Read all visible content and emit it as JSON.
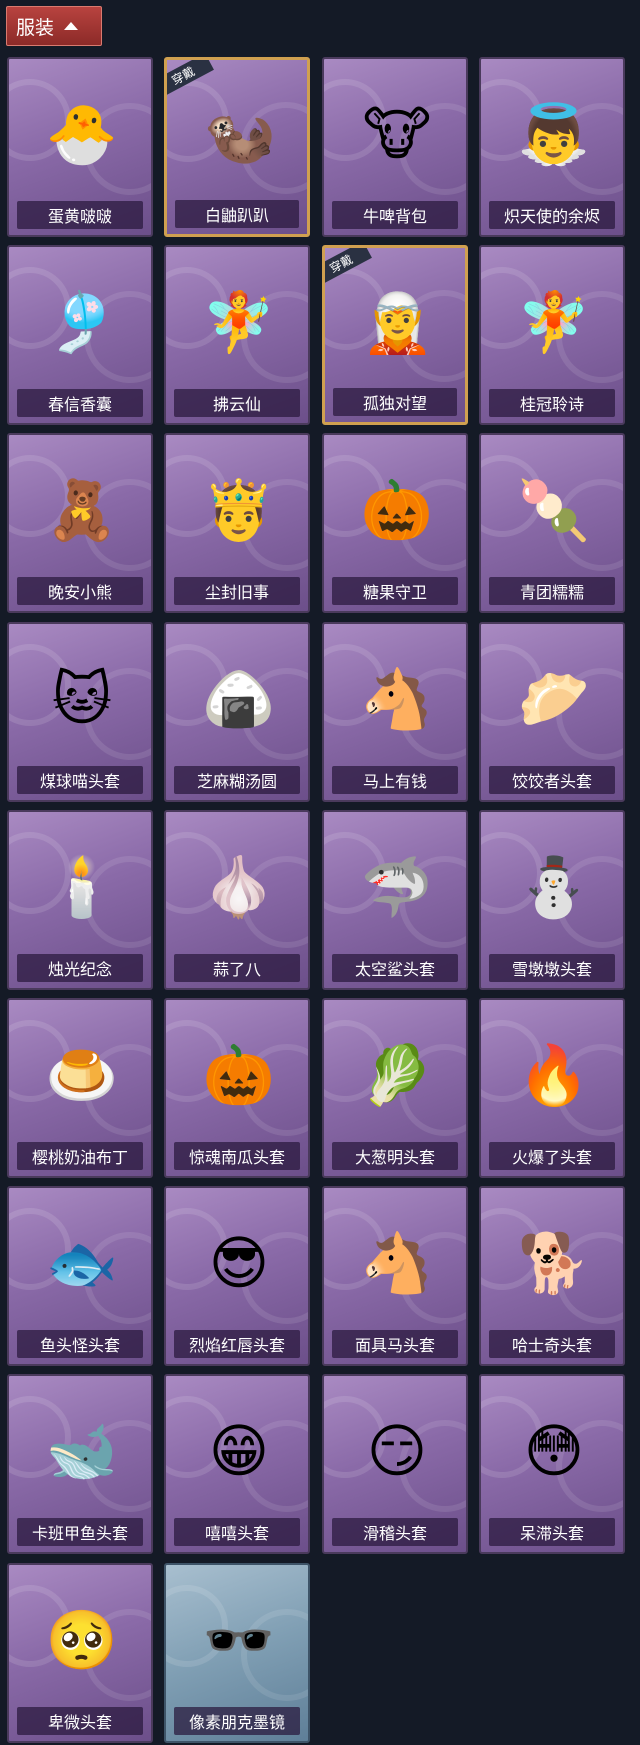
{
  "header": {
    "title": "服装"
  },
  "equipped_badge": "穿戴",
  "items": [
    {
      "name": "蛋黄啵啵",
      "icon": "chick-egg-icon",
      "glyph": "🐣",
      "equipped": false,
      "style": "purple"
    },
    {
      "name": "白鼬趴趴",
      "icon": "white-weasel-icon",
      "glyph": "🦦",
      "equipped": true,
      "style": "purple"
    },
    {
      "name": "牛啤背包",
      "icon": "cow-beer-backpack-icon",
      "glyph": "🐮",
      "equipped": false,
      "style": "purple"
    },
    {
      "name": "炽天使的余烬",
      "icon": "angel-doll-icon",
      "glyph": "👼",
      "equipped": false,
      "style": "purple"
    },
    {
      "name": "春信香囊",
      "icon": "sachet-icon",
      "glyph": "🎐",
      "equipped": false,
      "style": "purple"
    },
    {
      "name": "拂云仙",
      "icon": "cloud-fairy-charm-icon",
      "glyph": "🧚",
      "equipped": false,
      "style": "purple"
    },
    {
      "name": "孤独对望",
      "icon": "lonely-gaze-charm-icon",
      "glyph": "🧝",
      "equipped": true,
      "style": "purple"
    },
    {
      "name": "桂冠聆诗",
      "icon": "laurel-poet-charm-icon",
      "glyph": "🧚",
      "equipped": false,
      "style": "purple"
    },
    {
      "name": "晚安小熊",
      "icon": "bear-charm-icon",
      "glyph": "🧸",
      "equipped": false,
      "style": "purple"
    },
    {
      "name": "尘封旧事",
      "icon": "prince-charm-icon",
      "glyph": "🤴",
      "equipped": false,
      "style": "purple"
    },
    {
      "name": "糖果守卫",
      "icon": "pumpkin-scarecrow-icon",
      "glyph": "🎃",
      "equipped": false,
      "style": "purple"
    },
    {
      "name": "青团糯糯",
      "icon": "green-dumpling-icon",
      "glyph": "🍡",
      "equipped": false,
      "style": "purple"
    },
    {
      "name": "煤球喵头套",
      "icon": "black-cat-head-icon",
      "glyph": "🐱",
      "equipped": false,
      "style": "purple"
    },
    {
      "name": "芝麻糊汤圆",
      "icon": "rice-ball-head-icon",
      "glyph": "🍙",
      "equipped": false,
      "style": "purple"
    },
    {
      "name": "马上有钱",
      "icon": "red-horse-head-icon",
      "glyph": "🐴",
      "equipped": false,
      "style": "purple"
    },
    {
      "name": "饺饺者头套",
      "icon": "dumpling-head-icon",
      "glyph": "🥟",
      "equipped": false,
      "style": "purple"
    },
    {
      "name": "烛光纪念",
      "icon": "candle-head-icon",
      "glyph": "🕯️",
      "equipped": false,
      "style": "purple"
    },
    {
      "name": "蒜了八",
      "icon": "garlic-head-icon",
      "glyph": "🧄",
      "equipped": false,
      "style": "purple"
    },
    {
      "name": "太空鲨头套",
      "icon": "shark-head-icon",
      "glyph": "🦈",
      "equipped": false,
      "style": "purple"
    },
    {
      "name": "雪墩墩头套",
      "icon": "snowman-head-icon",
      "glyph": "⛄",
      "equipped": false,
      "style": "purple"
    },
    {
      "name": "樱桃奶油布丁",
      "icon": "pudding-head-icon",
      "glyph": "🍮",
      "equipped": false,
      "style": "purple"
    },
    {
      "name": "惊魂南瓜头套",
      "icon": "pumpkin-head-icon",
      "glyph": "🎃",
      "equipped": false,
      "style": "purple"
    },
    {
      "name": "大葱明头套",
      "icon": "scallion-head-icon",
      "glyph": "🥬",
      "equipped": false,
      "style": "purple"
    },
    {
      "name": "火爆了头套",
      "icon": "fire-head-icon",
      "glyph": "🔥",
      "equipped": false,
      "style": "purple"
    },
    {
      "name": "鱼头怪头套",
      "icon": "fish-head-icon",
      "glyph": "🐟",
      "equipped": false,
      "style": "purple"
    },
    {
      "name": "烈焰红唇头套",
      "icon": "yellow-mouse-head-icon",
      "glyph": "😎",
      "equipped": false,
      "style": "purple"
    },
    {
      "name": "面具马头套",
      "icon": "horse-mask-head-icon",
      "glyph": "🐴",
      "equipped": false,
      "style": "purple"
    },
    {
      "name": "哈士奇头套",
      "icon": "husky-head-icon",
      "glyph": "🐕",
      "equipped": false,
      "style": "purple"
    },
    {
      "name": "卡班甲鱼头套",
      "icon": "catfish-head-icon",
      "glyph": "🐋",
      "equipped": false,
      "style": "purple"
    },
    {
      "name": "嘻嘻头套",
      "icon": "grin-emoji-head-icon",
      "glyph": "😁",
      "equipped": false,
      "style": "purple"
    },
    {
      "name": "滑稽头套",
      "icon": "funny-emoji-head-icon",
      "glyph": "😏",
      "equipped": false,
      "style": "purple"
    },
    {
      "name": "呆滞头套",
      "icon": "dazed-emoji-head-icon",
      "glyph": "😳",
      "equipped": false,
      "style": "purple"
    },
    {
      "name": "卑微头套",
      "icon": "humble-emoji-head-icon",
      "glyph": "🥺",
      "equipped": false,
      "style": "purple"
    },
    {
      "name": "像素朋克墨镜",
      "icon": "pixel-sunglasses-icon",
      "glyph": "🕶️",
      "equipped": false,
      "style": "blue"
    }
  ]
}
